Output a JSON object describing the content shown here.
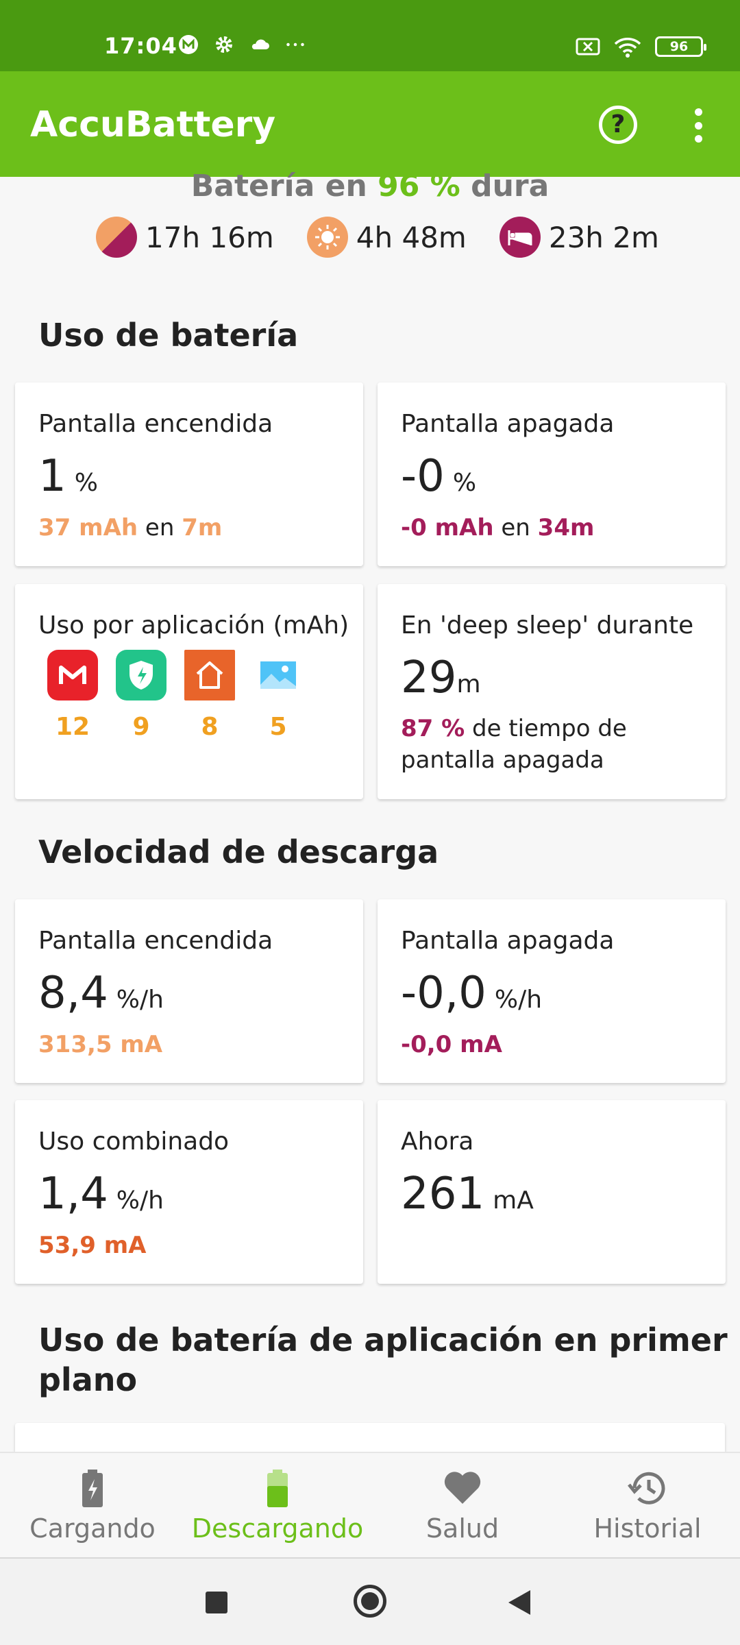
{
  "status_bar": {
    "time": "17:04",
    "battery_level": "96"
  },
  "app_bar": {
    "title": "AccuBattery",
    "help_glyph": "?"
  },
  "summary": {
    "title_prefix": "Batería en ",
    "title_percent": "96 %",
    "title_suffix": " dura",
    "combined": "17h 16m",
    "screen_on": "4h 48m",
    "screen_off": "23h 2m"
  },
  "battery_usage": {
    "title": "Uso de batería",
    "screen_on": {
      "label": "Pantalla encendida",
      "value": "1",
      "unit": "%",
      "mah": "37 mAh",
      "in": "en",
      "time": "7m"
    },
    "screen_off": {
      "label": "Pantalla apagada",
      "value": "-0",
      "unit": "%",
      "mah": "-0 mAh",
      "in": "en",
      "time": "34m"
    },
    "per_app": {
      "label": "Uso por aplicación (mAh)",
      "apps": [
        {
          "icon": "gmail-icon",
          "value": "12"
        },
        {
          "icon": "security-shield-icon",
          "value": "9"
        },
        {
          "icon": "home-launcher-icon",
          "value": "8"
        },
        {
          "icon": "gallery-icon",
          "value": "5"
        }
      ]
    },
    "deep_sleep": {
      "label": "En 'deep sleep' durante",
      "value": "29",
      "unit": "m",
      "percent": "87 %",
      "desc_1": " de tiempo de",
      "desc_2": "pantalla apagada"
    }
  },
  "discharge_speed": {
    "title": "Velocidad de descarga",
    "screen_on": {
      "label": "Pantalla encendida",
      "value": "8,4",
      "unit": "%/h",
      "current": "313,5 mA"
    },
    "screen_off": {
      "label": "Pantalla apagada",
      "value": "-0,0",
      "unit": "%/h",
      "current": "-0,0 mA"
    },
    "combined": {
      "label": "Uso combinado",
      "value": "1,4",
      "unit": "%/h",
      "current": "53,9 mA"
    },
    "now": {
      "label": "Ahora",
      "value": "261",
      "unit": "mA"
    }
  },
  "foreground": {
    "title_line1": "Uso de batería de aplicación en primer",
    "title_line2": "plano"
  },
  "bottom_nav": [
    {
      "label": "Cargando",
      "icon": "charging-battery-icon"
    },
    {
      "label": "Descargando",
      "icon": "discharging-battery-icon"
    },
    {
      "label": "Salud",
      "icon": "heart-icon"
    },
    {
      "label": "Historial",
      "icon": "history-icon"
    }
  ],
  "colors": {
    "header_dark": "#4a9a11",
    "header": "#6cbf1a",
    "orange": "#f2a065",
    "purple": "#a31d5a",
    "app_value": "#f0a020"
  }
}
